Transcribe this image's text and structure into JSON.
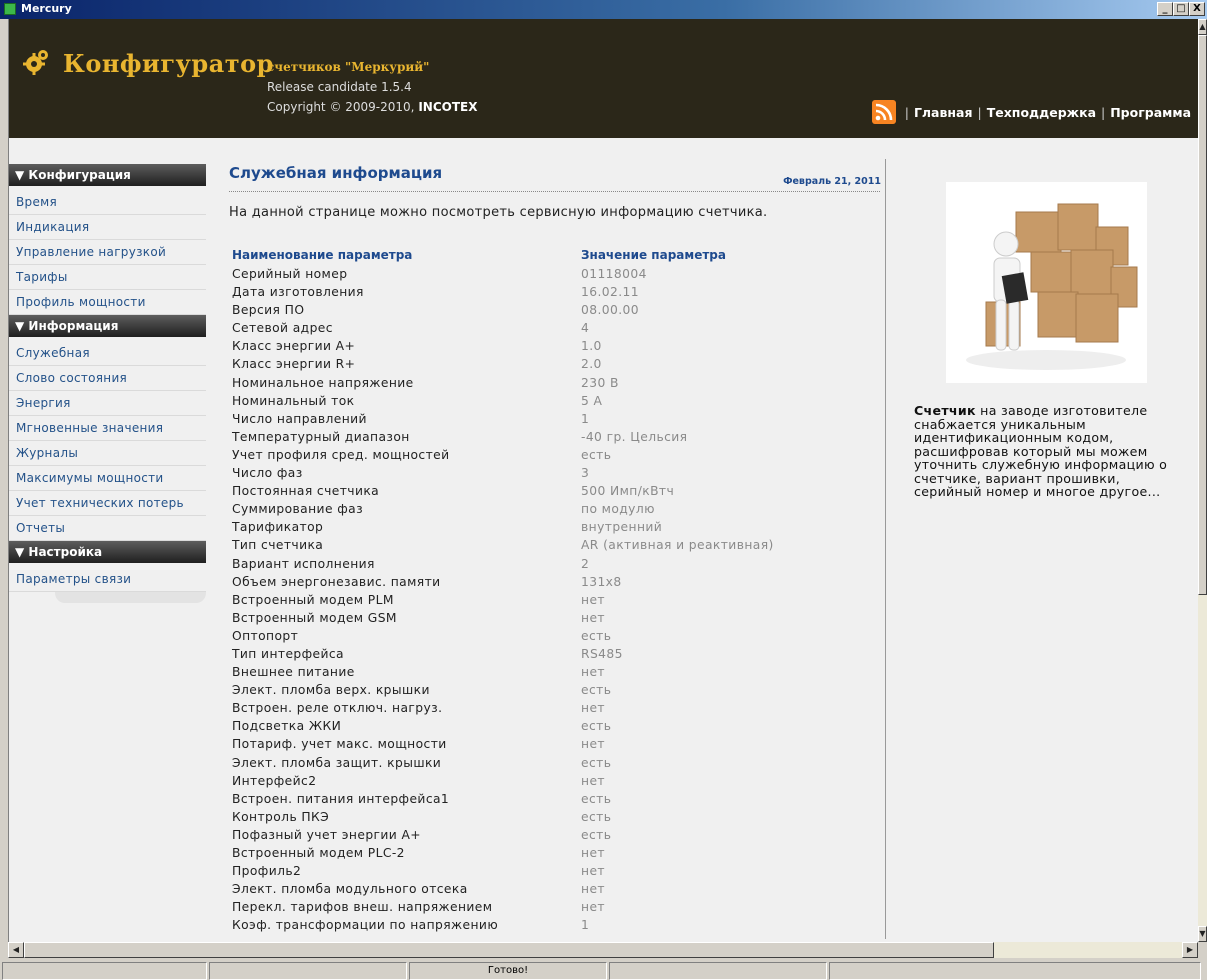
{
  "window": {
    "title": "Mercury",
    "min": "_",
    "max": "□",
    "close": "X"
  },
  "header": {
    "logo": "Конфигуратор",
    "logo_sub": "счетчиков \"Меркурий\"",
    "release": "Release candidate 1.5.4",
    "copyright_prefix": "Copyright © 2009-2010, ",
    "copyright_brand": "INCOTEX",
    "nav": [
      "Главная",
      "Техподдержка",
      "Программа"
    ]
  },
  "sidebar": {
    "sections": [
      {
        "title": "▼ Конфигурация",
        "items": [
          "Время",
          "Индикация",
          "Управление нагрузкой",
          "Тарифы",
          "Профиль мощности"
        ]
      },
      {
        "title": "▼ Информация",
        "items": [
          "Служебная",
          "Слово состояния",
          "Энергия",
          "Мгновенные значения",
          "Журналы",
          "Максимумы мощности",
          "Учет технических потерь",
          "Отчеты"
        ]
      },
      {
        "title": "▼ Настройка",
        "items": [
          "Параметры связи"
        ]
      }
    ]
  },
  "main": {
    "title": "Служебная информация",
    "date": "Февраль 21, 2011",
    "intro": "На данной странице можно посмотреть сервисную информацию счетчика.",
    "col_name": "Наименование параметра",
    "col_value": "Значение параметра",
    "rows": [
      [
        "Серийный номер",
        "01118004"
      ],
      [
        "Дата изготовления",
        "16.02.11"
      ],
      [
        "Версия ПО",
        "08.00.00"
      ],
      [
        "Сетевой адрес",
        "4"
      ],
      [
        "Класс энергии A+",
        "1.0"
      ],
      [
        "Класс энергии R+",
        "2.0"
      ],
      [
        "Номинальное напряжение",
        "230 В"
      ],
      [
        "Номинальный ток",
        "5 А"
      ],
      [
        "Число направлений",
        "1"
      ],
      [
        "Температурный диапазон",
        "-40 гр. Цельсия"
      ],
      [
        "Учет профиля сред. мощностей",
        "есть"
      ],
      [
        "Число фаз",
        "3"
      ],
      [
        "Постоянная счетчика",
        "500 Имп/кВтч"
      ],
      [
        "Суммирование фаз",
        "по модулю"
      ],
      [
        "Тарификатор",
        "внутренний"
      ],
      [
        "Тип счетчика",
        "AR (активная и реактивная)"
      ],
      [
        "Вариант исполнения",
        "2"
      ],
      [
        "Объем энергонезавис. памяти",
        "131x8"
      ],
      [
        "Встроенный модем PLM",
        "нет"
      ],
      [
        "Встроенный модем GSM",
        "нет"
      ],
      [
        "Оптопорт",
        "есть"
      ],
      [
        "Тип интерфейса",
        "RS485"
      ],
      [
        "Внешнее питание",
        "нет"
      ],
      [
        "Элект. пломба верх. крышки",
        "есть"
      ],
      [
        "Встроен. реле отключ. нагруз.",
        "нет"
      ],
      [
        "Подсветка ЖКИ",
        "есть"
      ],
      [
        "Потариф. учет макс. мощности",
        "нет"
      ],
      [
        "Элект. пломба защит. крышки",
        "есть"
      ],
      [
        "Интерфейс2",
        "нет"
      ],
      [
        "Встроен. питания интерфейса1",
        "есть"
      ],
      [
        "Контроль ПКЭ",
        "есть"
      ],
      [
        "Пофазный учет энергии A+",
        "есть"
      ],
      [
        "Встроенный модем PLC-2",
        "нет"
      ],
      [
        "Профиль2",
        "нет"
      ],
      [
        "Элект. пломба модульного отсека",
        "нет"
      ],
      [
        "Перекл. тарифов внеш. напряжением",
        "нет"
      ],
      [
        "Коэф. трансформации по напряжению",
        "1"
      ]
    ]
  },
  "aside": {
    "bold": "Счетчик",
    "text": " на заводе изготовителе снабжается уникальным идентификационным кодом, расшифровав который мы можем уточнить служебную информацию о счетчике, вариант прошивки, серийный номер и многое другое..."
  },
  "statusbar": {
    "text": "Готово!"
  },
  "colors": {
    "header_bg": "#2b2719",
    "logo": "#e9b530",
    "link": "#245289",
    "title": "#1e4a8e"
  },
  "icons": {
    "logo": "gear-icon",
    "rss": "rss-icon"
  }
}
